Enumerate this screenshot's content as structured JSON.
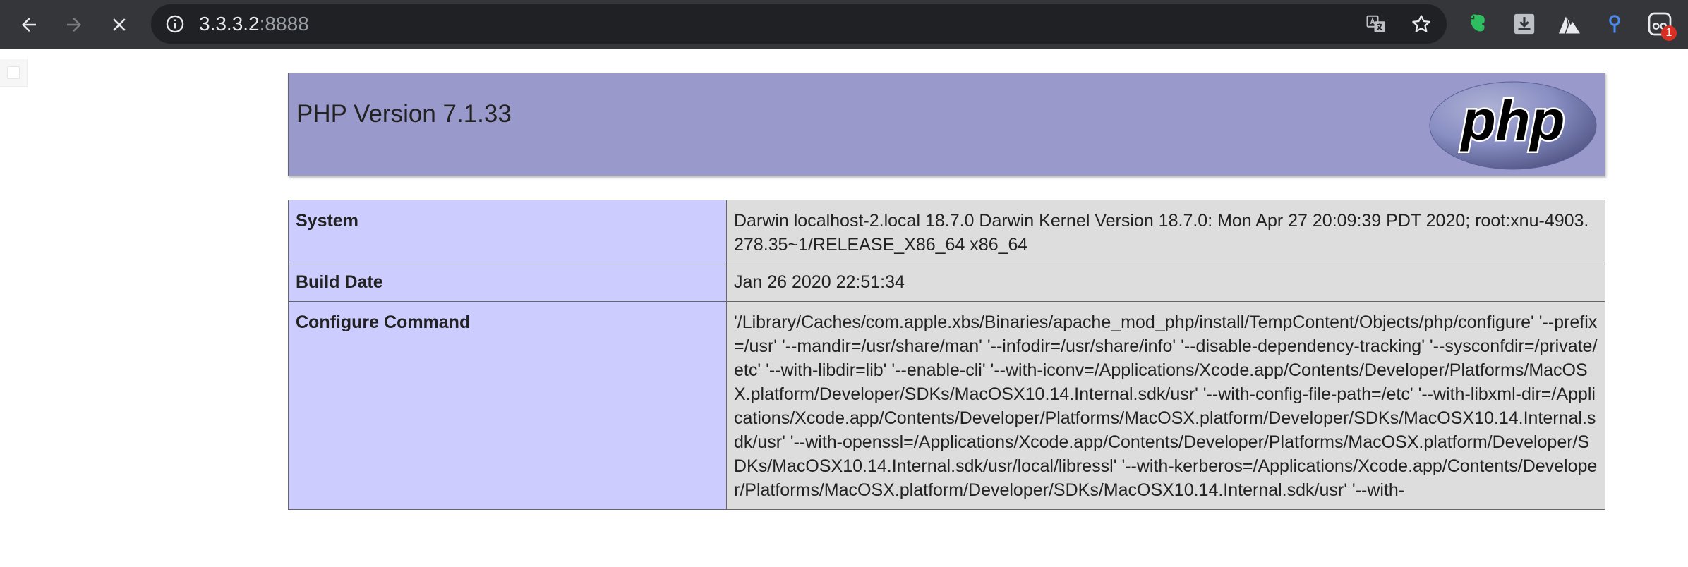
{
  "browser": {
    "url_host": "3.3.3.2",
    "url_port": ":8888",
    "extension_badge_count": "1",
    "accent_color": "#8ab4f8"
  },
  "page": {
    "title": "PHP Version 7.1.33",
    "logo_text": "php",
    "header_color": "#9999cc",
    "label_cell_color": "#ccccff",
    "value_cell_color": "#dddddd",
    "rows": [
      {
        "label": "System",
        "value": "Darwin localhost-2.local 18.7.0 Darwin Kernel Version 18.7.0: Mon Apr 27 20:09:39 PDT 2020; root:xnu-4903.278.35~1/RELEASE_X86_64 x86_64"
      },
      {
        "label": "Build Date",
        "value": "Jan 26 2020 22:51:34"
      },
      {
        "label": "Configure Command",
        "value": "'/Library/Caches/com.apple.xbs/Binaries/apache_mod_php/install/TempContent/Objects/php/configure' '--prefix=/usr' '--mandir=/usr/share/man' '--infodir=/usr/share/info' '--disable-dependency-tracking' '--sysconfdir=/private/etc' '--with-libdir=lib' '--enable-cli' '--with-iconv=/Applications/Xcode.app/Contents/Developer/Platforms/MacOSX.platform/Developer/SDKs/MacOSX10.14.Internal.sdk/usr' '--with-config-file-path=/etc' '--with-libxml-dir=/Applications/Xcode.app/Contents/Developer/Platforms/MacOSX.platform/Developer/SDKs/MacOSX10.14.Internal.sdk/usr' '--with-openssl=/Applications/Xcode.app/Contents/Developer/Platforms/MacOSX.platform/Developer/SDKs/MacOSX10.14.Internal.sdk/usr/local/libressl' '--with-kerberos=/Applications/Xcode.app/Contents/Developer/Platforms/MacOSX.platform/Developer/SDKs/MacOSX10.14.Internal.sdk/usr' '--with-"
      }
    ]
  }
}
